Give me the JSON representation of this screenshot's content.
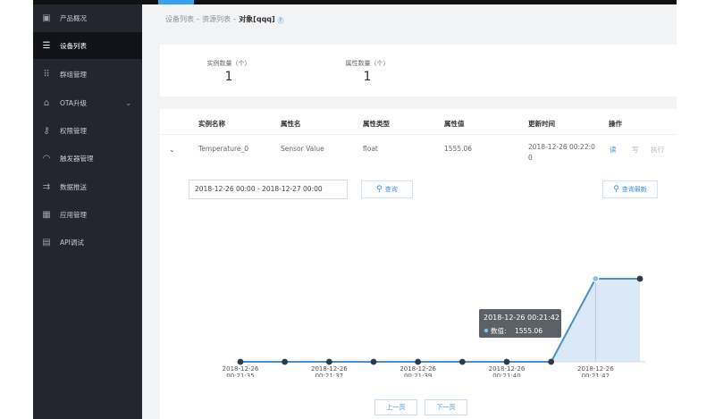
{
  "sidebar": {
    "items": [
      {
        "label": "产品概况",
        "icon": "cube-icon",
        "glyph": "▣"
      },
      {
        "label": "设备列表",
        "icon": "list-icon",
        "glyph": "☰"
      },
      {
        "label": "群组管理",
        "icon": "grid-dots-icon",
        "glyph": "⠿"
      },
      {
        "label": "OTA升级",
        "icon": "upload-icon",
        "glyph": "⌂"
      },
      {
        "label": "权限管理",
        "icon": "key-icon",
        "glyph": "⚷"
      },
      {
        "label": "触发器管理",
        "icon": "gauge-icon",
        "glyph": "◠"
      },
      {
        "label": "数据推送",
        "icon": "push-icon",
        "glyph": "⇉"
      },
      {
        "label": "应用管理",
        "icon": "apps-icon",
        "glyph": "▦"
      },
      {
        "label": "API调试",
        "icon": "terminal-icon",
        "glyph": "▤"
      }
    ],
    "active_index": 1,
    "ota_chevron": "⌄"
  },
  "breadcrumb": {
    "part1": "设备列表",
    "sep": "–",
    "part2": "资源列表",
    "current": "对象[qqq]",
    "help": "?"
  },
  "summary": {
    "instance_count_label": "实例数量（个）",
    "instance_count": "1",
    "attribute_count_label": "属性数量（个）",
    "attribute_count": "1"
  },
  "table": {
    "headers": [
      "实例名称",
      "属性名",
      "属性类型",
      "属性值",
      "更新时间",
      "操作"
    ],
    "row": {
      "instance": "Temperature_0",
      "attribute": "Sensor Value",
      "type": "float",
      "value": "1555.06",
      "updated_line1": "2018-12-26 00:22:0",
      "updated_line2": "0",
      "ops": [
        "读",
        "写",
        "执行"
      ]
    },
    "expander": "⌄"
  },
  "query": {
    "date_range": "2018-12-26 00:00 - 2018-12-27 00:00",
    "query_label": "查询",
    "latest_label": "查询最新",
    "search_glyph": "⚲"
  },
  "chart_data": {
    "type": "line",
    "x": [
      "2018-12-26 00:21:35",
      "2018-12-26 00:21:36",
      "2018-12-26 00:21:37",
      "2018-12-26 00:21:38",
      "2018-12-26 00:21:39",
      "2018-12-26 00:21:39",
      "2018-12-26 00:21:40",
      "2018-12-26 00:21:41",
      "2018-12-26 00:21:42",
      "2018-12-26 00:21:42"
    ],
    "values": [
      0,
      0,
      0,
      0,
      0,
      0,
      0,
      0,
      1555.06,
      1555.06
    ],
    "tick_labels": [
      {
        "index": 0,
        "line1": "2018-12-26",
        "line2": "00:21:35"
      },
      {
        "index": 2,
        "line1": "2018-12-26",
        "line2": "00:21:37"
      },
      {
        "index": 4,
        "line1": "2018-12-26",
        "line2": "00:21:39"
      },
      {
        "index": 6,
        "line1": "2018-12-26",
        "line2": "00:21:40"
      },
      {
        "index": 8,
        "line1": "2018-12-26",
        "line2": "00:21:42"
      }
    ],
    "ylim": [
      0,
      1555.06
    ],
    "tooltip": {
      "title": "2018-12-26 00:21:42",
      "label": "数值:",
      "value": "1555.06",
      "index": 8
    },
    "line_color": "#4a8fc8",
    "area_color": "#dbe9f7"
  },
  "pager": {
    "prev": "上一页",
    "next": "下一页"
  }
}
